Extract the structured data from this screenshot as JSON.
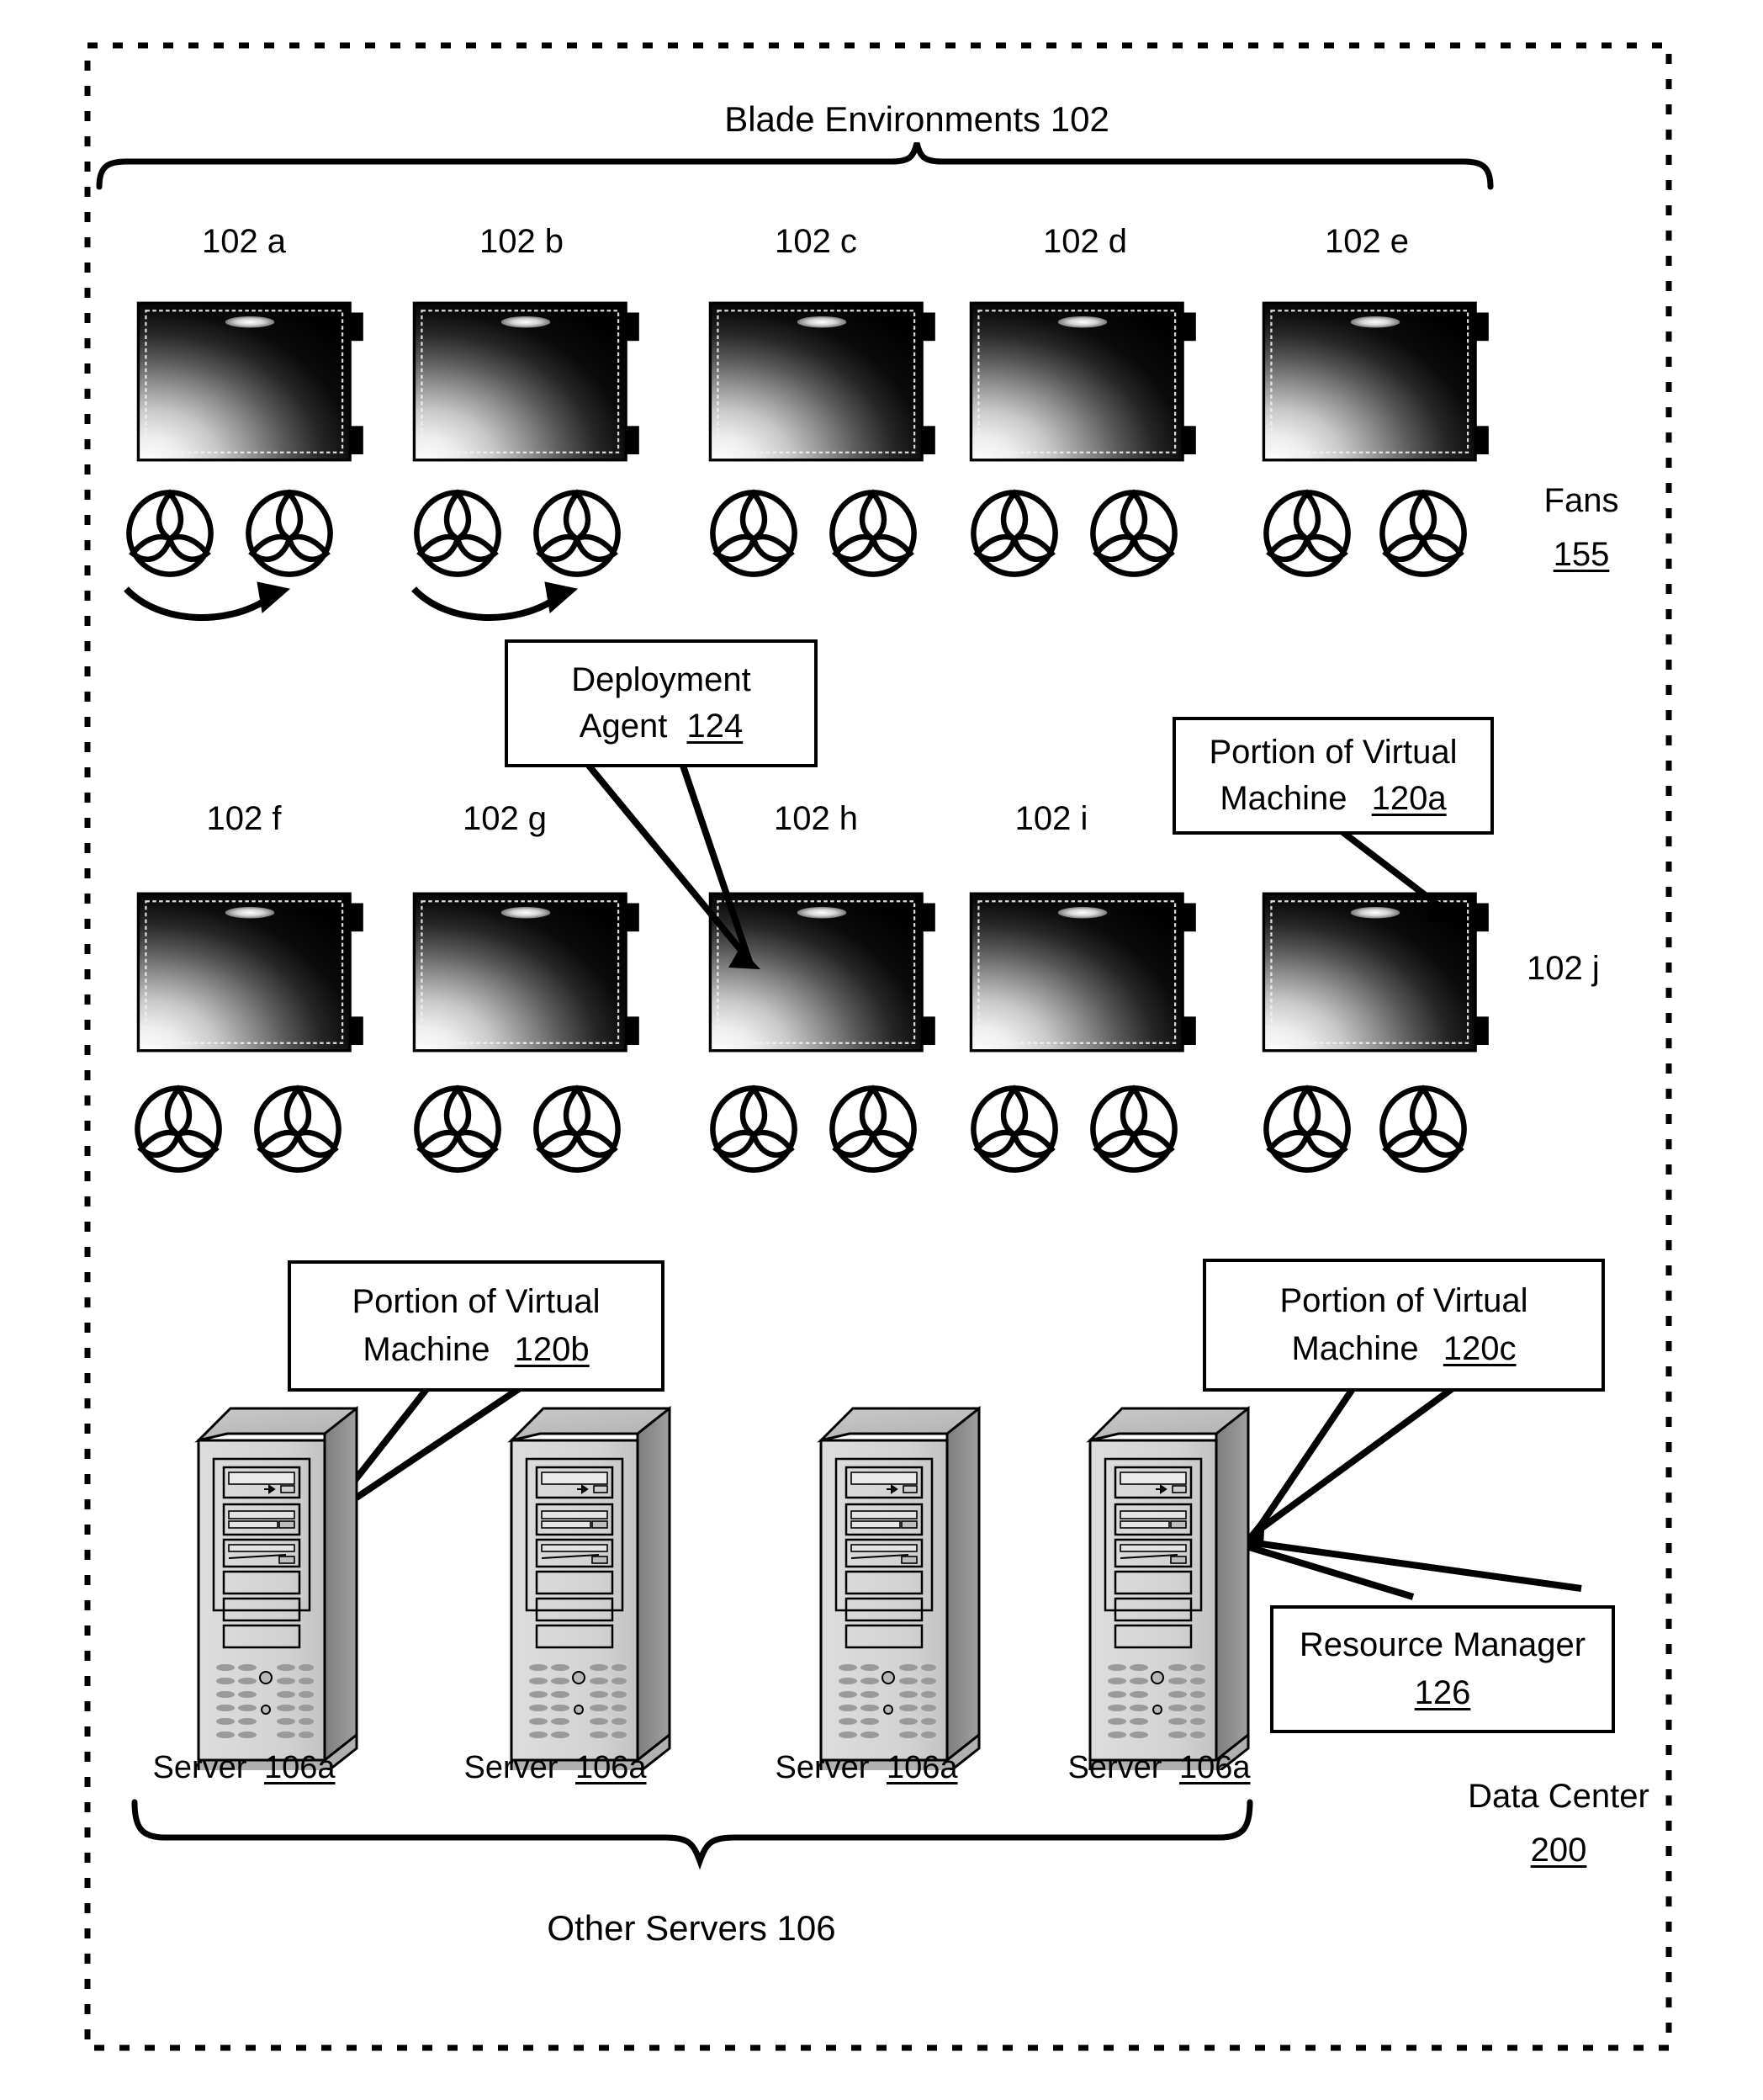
{
  "figure": {
    "title": "Blade Environments 102",
    "frame_label_line1": "Data Center",
    "frame_label_line2": "200",
    "bottom_brace_label": "Other Servers 106",
    "fans_label_line1": "Fans",
    "fans_label_line2": "155",
    "right_blade_label": "102 j"
  },
  "blades": {
    "row1": [
      {
        "label": "102 a",
        "fan_arrow": true
      },
      {
        "label": "102 b",
        "fan_arrow": true
      },
      {
        "label": "102 c",
        "fan_arrow": false
      },
      {
        "label": "102 d",
        "fan_arrow": false
      },
      {
        "label": "102 e",
        "fan_arrow": false
      }
    ],
    "row2": [
      {
        "label": "102 f",
        "fan_arrow": false
      },
      {
        "label": "102 g",
        "fan_arrow": false
      },
      {
        "label": "102 h",
        "fan_arrow": false
      },
      {
        "label": "102 i",
        "fan_arrow": false
      },
      {
        "label": "",
        "fan_arrow": false
      }
    ]
  },
  "callouts": {
    "deployment_agent": {
      "line1": "Deployment",
      "line2_text": "Agent",
      "line2_ref": "124"
    },
    "vm_120a": {
      "line1": "Portion of Virtual",
      "line2_text": "Machine",
      "line2_ref": "120a"
    },
    "vm_120b": {
      "line1": "Portion of Virtual",
      "line2_text": "Machine",
      "line2_ref": "120b"
    },
    "vm_120c": {
      "line1": "Portion of Virtual",
      "line2_text": "Machine",
      "line2_ref": "120c"
    },
    "resource_manager": {
      "line1": "Resource Manager",
      "line2_ref": "126"
    }
  },
  "servers": [
    {
      "label_text": "Server",
      "label_ref": "106a"
    },
    {
      "label_text": "Server",
      "label_ref": "106a"
    },
    {
      "label_text": "Server",
      "label_ref": "106a"
    },
    {
      "label_text": "Server",
      "label_ref": "106a"
    }
  ],
  "icons": {
    "fan": "fan-icon",
    "blade": "blade-server-icon",
    "tower": "tower-server-icon",
    "brace": "curly-brace-icon",
    "rotation_arrow": "rotation-arrow-icon"
  },
  "colors": {
    "ink": "#000000",
    "paper": "#ffffff",
    "tower_front": "#d9d9d9",
    "tower_side": "#8a8a8a",
    "tower_top": "#cccccc"
  }
}
